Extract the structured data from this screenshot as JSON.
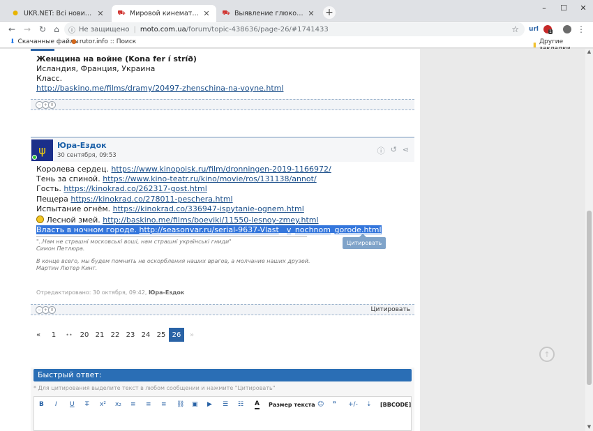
{
  "browser": {
    "tabs": [
      {
        "title": "UKR.NET: Всі новини України, о",
        "icon": "ukrnet-favicon",
        "active": false
      },
      {
        "title": "Мировой кинематограф - фору",
        "icon": "moto-favicon",
        "active": true
      },
      {
        "title": "Выявление глюков, предложен",
        "icon": "moto-favicon",
        "active": false
      }
    ],
    "new_tab": "+",
    "window_controls": {
      "minimize": "–",
      "maximize": "☐",
      "close": "✕"
    },
    "address": {
      "security_label": "Не защищено",
      "host": "moto.com.ua",
      "path": "/forum/topic-438636/page-26/#1741433"
    },
    "bookmarks": [
      {
        "label": "Скачанные файлы",
        "icon": "download-icon"
      },
      {
        "label": "rutor.info :: Поиск",
        "icon": "rutor-favicon"
      }
    ],
    "other_bookmarks": "Другие закладки",
    "ext_badge": "1"
  },
  "post1": {
    "title": "Женщина на войне (Kona fer í stríð)",
    "line2": "Исландия, Франция, Украина",
    "line3": "Класс.",
    "link": "http://baskino.me/films/dramy/20497-zhenschina-na-voyne.html"
  },
  "post2": {
    "author": "Юра-Ездок",
    "date": "30 сентября, 09:53",
    "lines": [
      {
        "text": " Королева сердец.  ",
        "link": "https://www.kinopoisk.ru/film/dronningen-2019-1166972/"
      },
      {
        "text": "Тень за спиной.  ",
        "link": "https://www.kino-teatr.ru/kino/movie/ros/131138/annot/"
      },
      {
        "text": "Гость. ",
        "link": "https://kinokrad.co/262317-gost.html"
      },
      {
        "text": "Пещера  ",
        "link": "https://kinokrad.co/278011-peschera.html"
      },
      {
        "text": "Испытание огнём. ",
        "link": "https://kinokrad.co/336947-ispytanie-ognem.html"
      },
      {
        "text": " Лесной змей.  ",
        "link": "http://baskino.me/films/boeviki/11550-lesnoy-zmey.html"
      },
      {
        "text": "Власть в ночном городе.  ",
        "link": "http://seasonvar.ru/serial-9637-Vlast__v_nochnom_gorode.html"
      }
    ],
    "tooltip": "Цитировать",
    "signature": {
      "quote1": "\"..Нам не страшні московські воші, нам страшні українські гниди\"",
      "author1": "Симон Петлюра.",
      "quote2": "В конце всего, мы будем помнить не оскорбления наших врагов, а молчание наших друзей.",
      "author2": "Мартин Лютер Кинг."
    },
    "edited_prefix": "Отредактировано: 30 октября, 09:42, ",
    "edited_by": "Юра-Ездок",
    "quote_button": "Цитировать"
  },
  "pagination": {
    "prev": "«",
    "items": [
      "1",
      "••",
      "20",
      "21",
      "22",
      "23",
      "24",
      "25",
      "26"
    ],
    "current": "26",
    "next": "»"
  },
  "quick_reply": {
    "title": "Быстрый ответ:",
    "hint": "* Для цитирования выделите текст в любом сообщении и нажмите \"Цитировать\"",
    "toolbar": [
      "B",
      "I",
      "U",
      "T",
      "x²",
      "x₂",
      "≡",
      "≡",
      "≡",
      "⛓",
      "▣",
      "▶",
      "☰",
      "☷",
      "A",
      "Размер текста",
      "☺",
      "❞",
      "+/-",
      "⇣",
      "[BBCODE]"
    ]
  },
  "colors": {
    "accent": "#2a63a6",
    "selection": "#3476dc",
    "link": "#1b4f8a"
  }
}
